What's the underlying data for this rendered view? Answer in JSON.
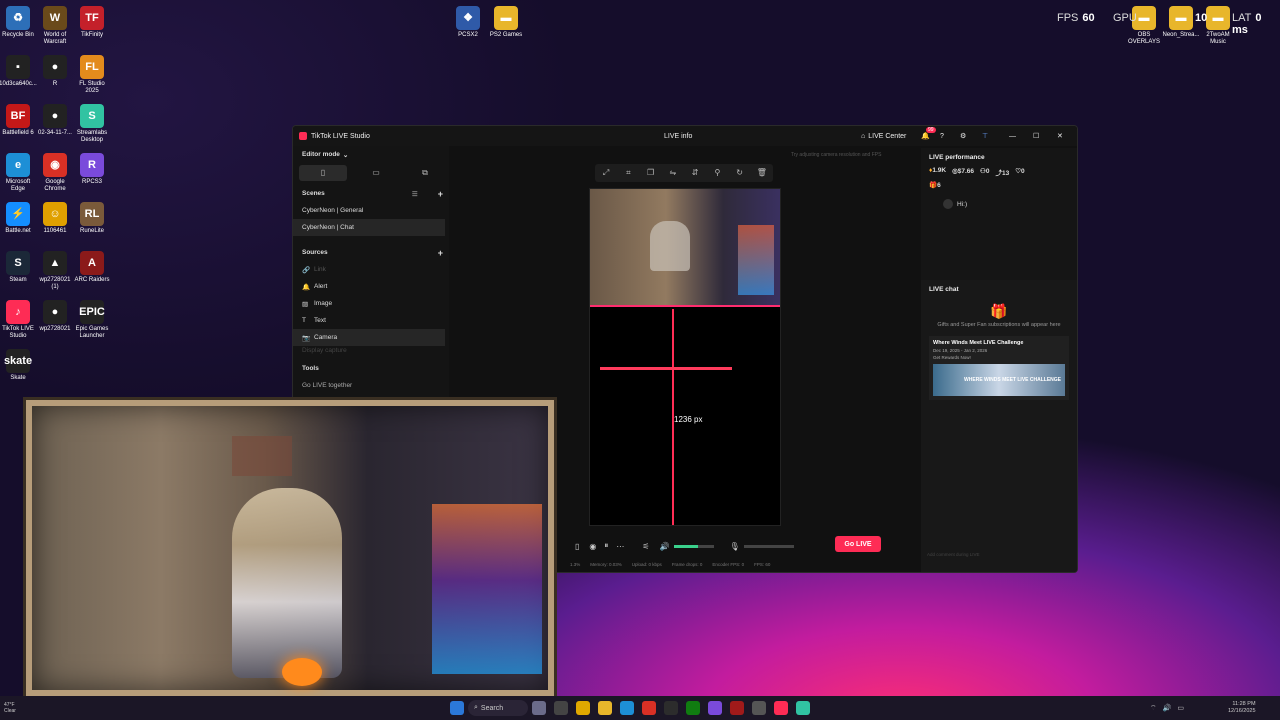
{
  "desktop": {
    "icons_left": [
      {
        "label": "Recycle Bin",
        "glyph": "♻",
        "color": "#2d6fb8"
      },
      {
        "label": "World of Warcraft",
        "glyph": "W",
        "color": "#6a4a1a"
      },
      {
        "label": "TikFinity",
        "glyph": "TF",
        "color": "#c4202a"
      },
      {
        "label": "10d3ca640c...",
        "glyph": "▪",
        "color": "#222"
      },
      {
        "label": "R",
        "glyph": "●",
        "color": "#222"
      },
      {
        "label": "FL Studio 2025",
        "glyph": "FL",
        "color": "#e38b1c"
      },
      {
        "label": "Battlefield 6",
        "glyph": "BF",
        "color": "#c41818"
      },
      {
        "label": "02-34-11-7...",
        "glyph": "●",
        "color": "#222"
      },
      {
        "label": "Streamlabs Desktop",
        "glyph": "S",
        "color": "#31c3a2"
      },
      {
        "label": "Microsoft Edge",
        "glyph": "e",
        "color": "#1d8fd6"
      },
      {
        "label": "Google Chrome",
        "glyph": "◉",
        "color": "#d93025"
      },
      {
        "label": "RPCS3",
        "glyph": "R",
        "color": "#7a4adb"
      },
      {
        "label": "Battle.net",
        "glyph": "⚡",
        "color": "#148eff"
      },
      {
        "label": "1106461",
        "glyph": "☺",
        "color": "#e0a000"
      },
      {
        "label": "RuneLite",
        "glyph": "RL",
        "color": "#7a5a3a"
      },
      {
        "label": "Steam",
        "glyph": "S",
        "color": "#1b2838"
      },
      {
        "label": "wp2728021 (1)",
        "glyph": "▲",
        "color": "#222"
      },
      {
        "label": "ARC Raiders",
        "glyph": "A",
        "color": "#8b1a1a"
      },
      {
        "label": "TikTok LIVE Studio",
        "glyph": "♪",
        "color": "#fe2c55"
      },
      {
        "label": "wp2728021",
        "glyph": "●",
        "color": "#222"
      },
      {
        "label": "Epic Games Launcher",
        "glyph": "EPIC",
        "color": "#222"
      },
      {
        "label": "Skate",
        "glyph": "skate",
        "color": "#222"
      }
    ],
    "icons_top": [
      {
        "label": "PCSX2",
        "glyph": "❖",
        "color": "#2f5aa8"
      },
      {
        "label": "PS2 Games",
        "glyph": "▬",
        "color": "#e8b62b"
      }
    ],
    "icons_top_right": [
      {
        "label": "OBS OVERLAYS",
        "glyph": "▬",
        "color": "#e8b62b"
      },
      {
        "label": "Neon_Strea...",
        "glyph": "▬",
        "color": "#e8b62b"
      },
      {
        "label": "2TwoAM Music",
        "glyph": "▬",
        "color": "#e8b62b"
      }
    ],
    "hud": {
      "fps_label": "FPS",
      "fps_value": "60",
      "gpu_label": "GPU",
      "gpu_value": "10",
      "lat_label": "LAT",
      "lat_value": "0 ms"
    }
  },
  "app": {
    "title": "TikTok LIVE Studio",
    "live_info": "LIVE info",
    "live_center": "LIVE Center",
    "notif_badge": "99",
    "editor_mode": "Editor mode",
    "scenes_header": "Scenes",
    "scenes": [
      "CyberNeon | General",
      "CyberNeon | Chat"
    ],
    "sources_header": "Sources",
    "sources": [
      "Link",
      "Alert",
      "Image",
      "Text",
      "Camera",
      "Display capture"
    ],
    "tools_header": "Tools",
    "tools": [
      "Go LIVE together"
    ],
    "canvas_hint": "Try adjusting camera resolution and FPS",
    "measure_label": "1236 px",
    "go_live": "Go LIVE",
    "status": {
      "cpu": "1.3%",
      "memory": "Memory: 0.03%",
      "upload": "Upload: 0 kbps",
      "frame_drops": "Frame drops: 0",
      "encoder_fps": "Encoder FPS: 0",
      "fps": "FPS: 60"
    },
    "right": {
      "perf_title": "LIVE performance",
      "stats": [
        {
          "icon": "viewers",
          "value": "1.9K"
        },
        {
          "icon": "money",
          "value": "$7.66"
        },
        {
          "icon": "person",
          "value": "0"
        },
        {
          "icon": "share",
          "value": "13"
        },
        {
          "icon": "heart",
          "value": "0"
        }
      ],
      "gifts_count": "6",
      "viewer_msg": "Hi:)",
      "chat_title": "LIVE chat",
      "chat_empty": "Gifts and Super Fan subscriptions will appear here",
      "promo_title": "Where Winds Meet LIVE Challenge",
      "promo_dates": "Dec 19, 2025 - Jan 2, 2026",
      "promo_cta": "Get Rewards Now!",
      "promo_banner": "WHERE WINDS MEET LIVE CHALLENGE",
      "chat_placeholder": "Add comment during LIVE"
    }
  },
  "taskbar": {
    "search": "Search",
    "time": "11:28 PM",
    "date": "12/16/2025",
    "weather_temp": "47°F",
    "weather_desc": "Clear"
  }
}
